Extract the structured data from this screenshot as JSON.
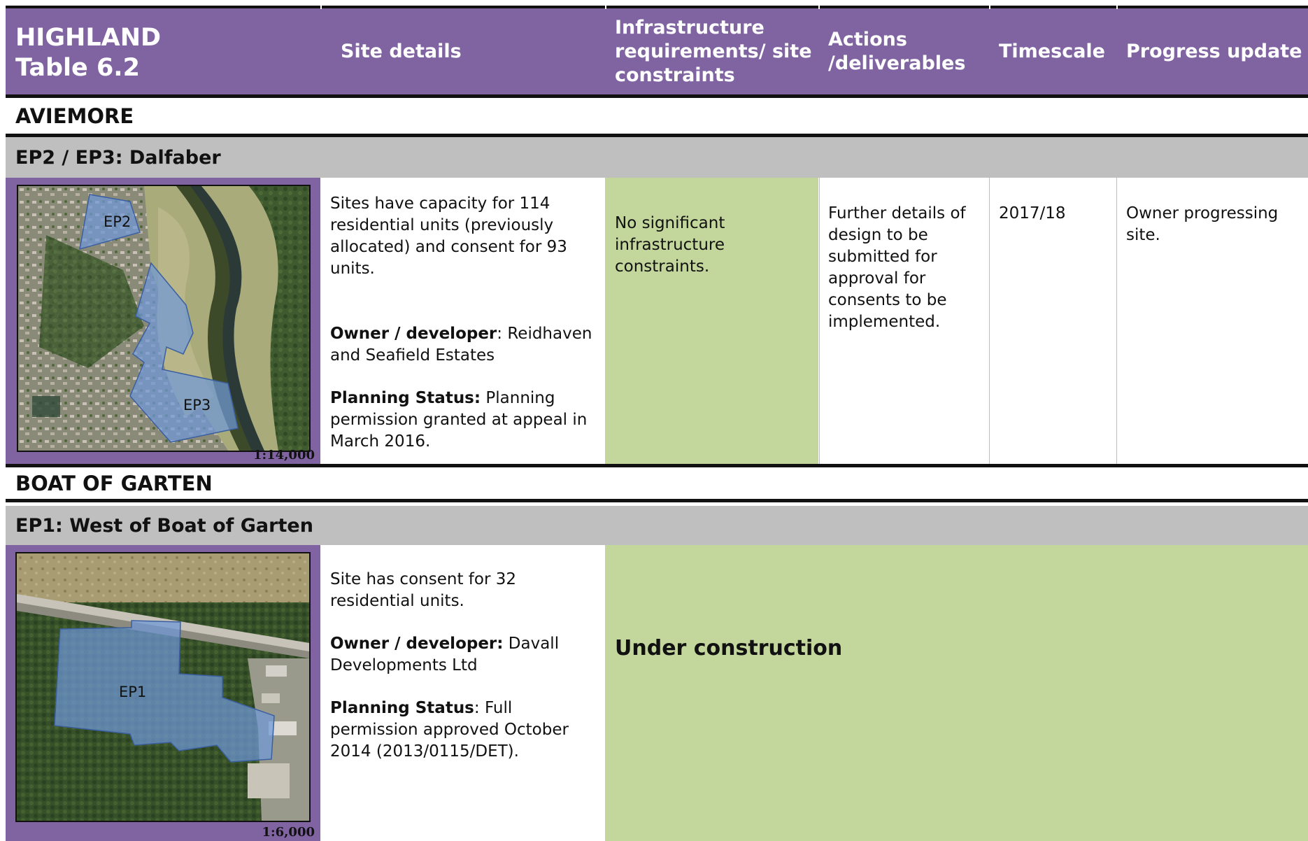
{
  "header": {
    "region": "HIGHLAND",
    "table": "Table 6.2",
    "columns": [
      "Site details",
      "Infrastructure requirements/ site constraints",
      "Actions /deliverables",
      "Timescale",
      "Progress update"
    ]
  },
  "sections": [
    {
      "town": "AVIEMORE",
      "site_title": "EP2 / EP3: Dalfaber",
      "map": {
        "labels": [
          "EP2",
          "EP3"
        ],
        "scale": "1:14,000"
      },
      "details": {
        "capacity": "Sites have capacity for 114 residential units (previously allocated) and consent for 93 units.",
        "owner_label": "Owner / developer",
        "owner_value": ": Reidhaven and Seafield Estates",
        "status_label": "Planning Status:",
        "status_value": " Planning permission granted at appeal in March 2016."
      },
      "infrastructure": "No significant infrastructure constraints.",
      "actions": "Further details of design to be submitted for approval for consents to be implemented.",
      "timescale": "2017/18",
      "progress": "Owner progressing site."
    },
    {
      "town": "BOAT OF GARTEN",
      "site_title": "EP1: West of Boat of Garten",
      "map": {
        "labels": [
          "EP1"
        ],
        "scale": "1:6,000"
      },
      "details": {
        "capacity": "Site has consent for 32 residential units.",
        "owner_label": "Owner / developer:",
        "owner_value": " Davall Developments Ltd",
        "status_label": "Planning Status",
        "status_value": ": Full permission approved October 2014 (2013/0115/DET)."
      },
      "status_banner": "Under construction"
    }
  ],
  "colors": {
    "header_purple": "#8064a2",
    "site_grey": "#bfbfbf",
    "cell_green": "#c3d69b",
    "site_polygon_blue": "#6f98d8"
  }
}
